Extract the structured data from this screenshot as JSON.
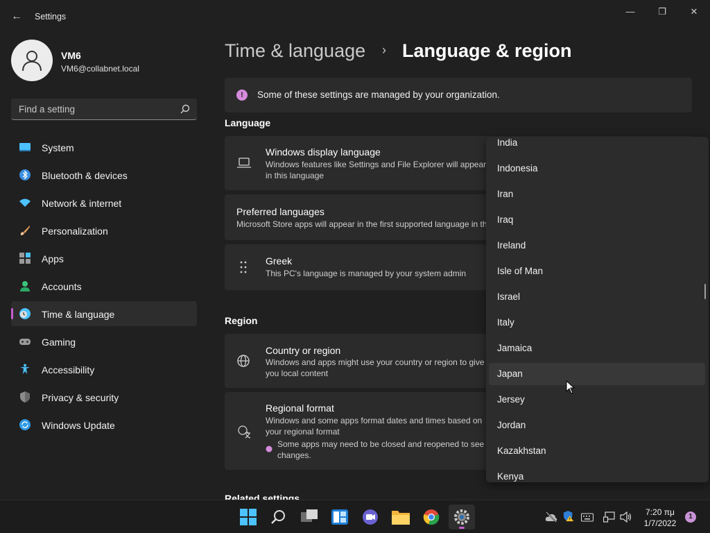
{
  "window": {
    "title": "Settings",
    "back_glyph": "←",
    "minimize_glyph": "—",
    "maximize_glyph": "❐",
    "close_glyph": "✕"
  },
  "profile": {
    "name": "VM6",
    "email": "VM6@collabnet.local"
  },
  "search": {
    "placeholder": "Find a setting"
  },
  "nav": {
    "items": [
      {
        "label": "System",
        "icon": "system-icon"
      },
      {
        "label": "Bluetooth & devices",
        "icon": "bluetooth-icon"
      },
      {
        "label": "Network & internet",
        "icon": "wifi-icon"
      },
      {
        "label": "Personalization",
        "icon": "brush-icon"
      },
      {
        "label": "Apps",
        "icon": "apps-icon"
      },
      {
        "label": "Accounts",
        "icon": "person-icon"
      },
      {
        "label": "Time & language",
        "icon": "clock-globe-icon",
        "active": true
      },
      {
        "label": "Gaming",
        "icon": "gamepad-icon"
      },
      {
        "label": "Accessibility",
        "icon": "accessibility-icon"
      },
      {
        "label": "Privacy & security",
        "icon": "shield-icon"
      },
      {
        "label": "Windows Update",
        "icon": "update-icon"
      }
    ]
  },
  "breadcrumb": {
    "parent": "Time & language",
    "separator": "›",
    "current": "Language & region"
  },
  "banner": {
    "icon_glyph": "!",
    "text": "Some of these settings are managed by your organization."
  },
  "sections": {
    "language": "Language",
    "region": "Region",
    "related": "Related settings"
  },
  "cards": {
    "display_language": {
      "title": "Windows display language",
      "desc": "Windows features like Settings and File Explorer will appear in this language"
    },
    "preferred_languages": {
      "title": "Preferred languages",
      "desc": "Microsoft Store apps will appear in the first supported language in this list"
    },
    "greek": {
      "title": "Greek",
      "desc": "This PC's language is managed by your system admin"
    },
    "country": {
      "title": "Country or region",
      "desc": "Windows and apps might use your country or region to give you local content"
    },
    "regional_format": {
      "title": "Regional format",
      "desc": "Windows and some apps format dates and times based on your regional format",
      "note": "Some apps may need to be closed and reopened to see changes."
    }
  },
  "dropdown": {
    "items": [
      "India",
      "Indonesia",
      "Iran",
      "Iraq",
      "Ireland",
      "Isle of Man",
      "Israel",
      "Italy",
      "Jamaica",
      "Japan",
      "Jersey",
      "Jordan",
      "Kazakhstan",
      "Kenya"
    ],
    "hovered": "Japan"
  },
  "taskbar": {
    "apps": [
      "start-icon",
      "search-icon",
      "task-view-icon",
      "widgets-icon",
      "teams-chat-icon",
      "file-explorer-icon",
      "chrome-icon",
      "settings-icon"
    ],
    "clock_time": "7:20 πμ",
    "clock_date": "1/7/2022",
    "notification_count": "1"
  },
  "colors": {
    "accent": "#c45fd0",
    "background": "#202020",
    "card": "#2b2b2b"
  }
}
